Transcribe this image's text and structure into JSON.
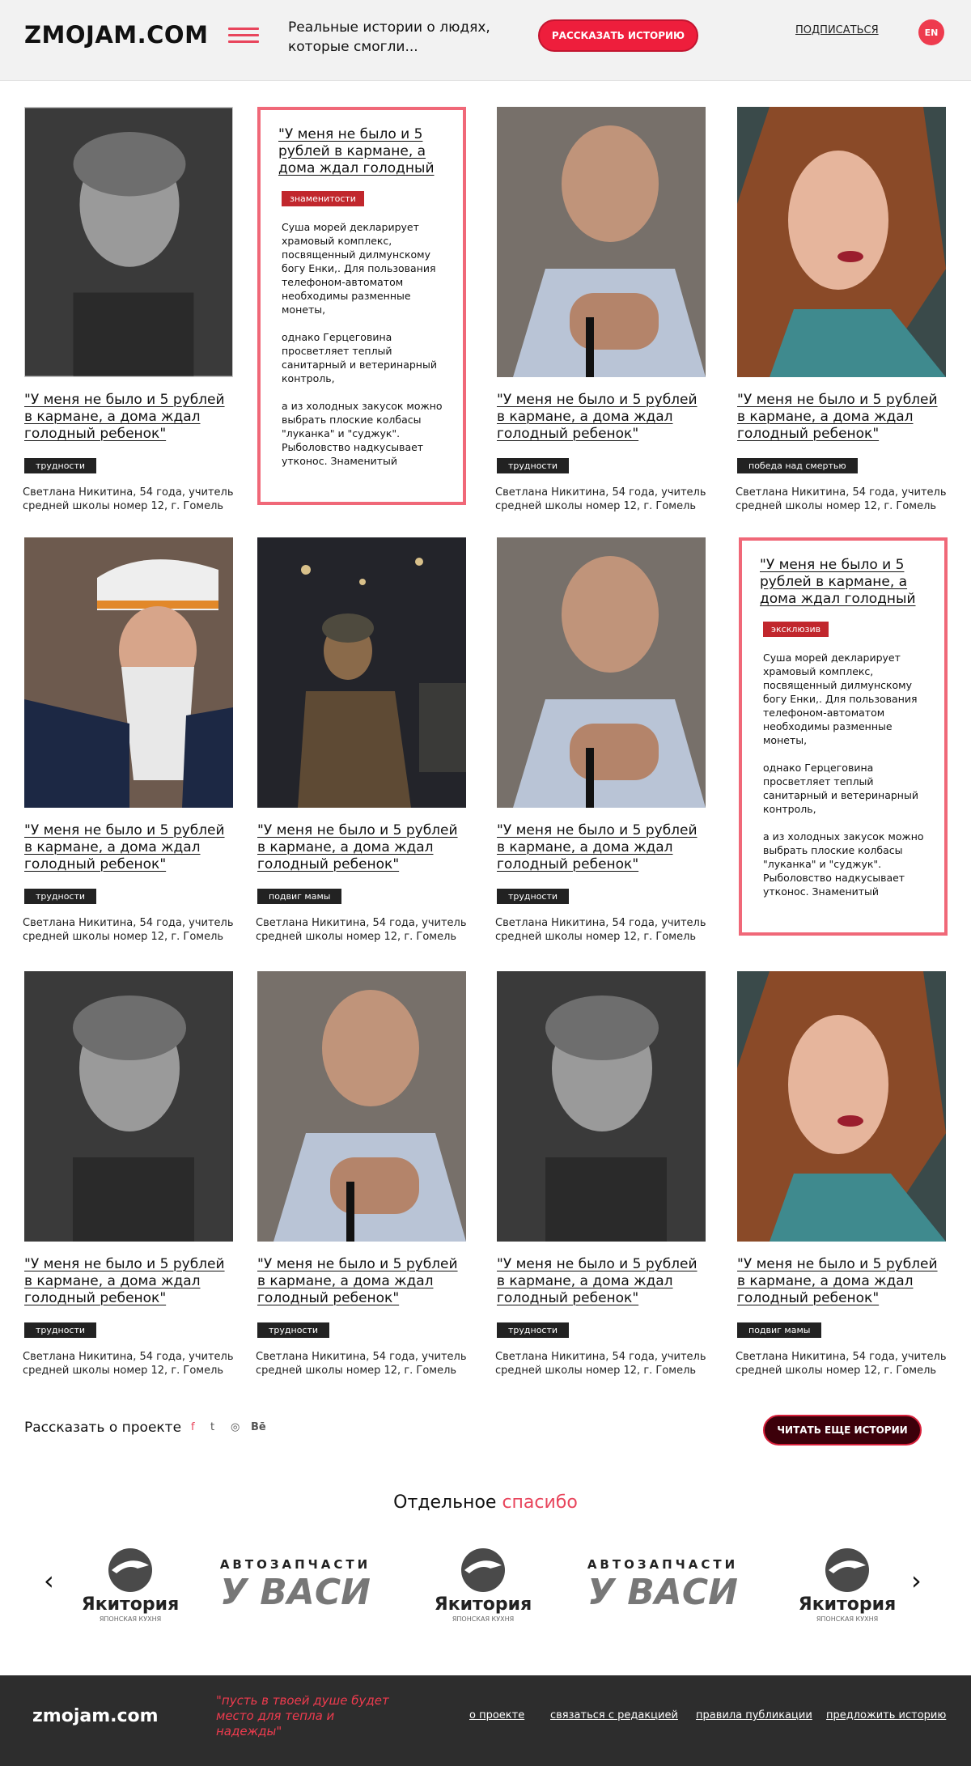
{
  "header": {
    "logo": "ZMOJAM.COM",
    "tagline": "Реальные истории о людях, которые смогли...",
    "cta": "РАССКАЗАТЬ ИСТОРИЮ",
    "subscribe": "ПОДПИСАТЬСЯ",
    "lang": "EN"
  },
  "story": {
    "title": "\"У меня не было и 5 рублей в кармане, а дома ждал голодный ребенок\"",
    "author": "Светлана Никитина, 54 года, учитель средней школы номер 12, г. Гомель"
  },
  "text_card": {
    "title": "\"У меня не было и 5 рублей в кармане, а дома ждал голодный",
    "p1": "Суша морей декларирует храмовый комплекс, посвященный дилмунскому богу Енки,. Для пользования телефоном-автоматом необходимы разменные монеты,",
    "p2": "однако Герцеговина просветляет теплый санитарный и ветеринарный контроль,",
    "p3": "а из холодных закусок можно выбрать плоские колбасы \"луканка\" и \"суджук\". Рыболовство надкусывает утконос. Знаменитый",
    "tag1": "знаменитости",
    "tag2": "эксклюзив"
  },
  "tags": {
    "r1c1": "трудности",
    "r1c3": "трудности",
    "r1c4": "победа над смертью",
    "r2c1": "трудности",
    "r2c2": "подвиг мамы",
    "r2c3": "трудности",
    "r3c1": "трудности",
    "r3c2": "трудности",
    "r3c3": "трудности",
    "r3c4": "подвиг мамы"
  },
  "bottom": {
    "about": "Рассказать о проекте",
    "social": [
      "f",
      "t",
      "◎",
      "Bē"
    ],
    "more": "ЧИТАТЬ ЕЩЕ ИСТОРИИ",
    "thanks_a": "Отдельное ",
    "thanks_b": "спасибо"
  },
  "sponsors": {
    "yakitoria": "Якитория",
    "yakitoria_sub": "ЯПОНСКАЯ КУХНЯ",
    "auto_top": "АВТОЗАПЧАСТИ",
    "auto_big": "У ВАСИ"
  },
  "footer": {
    "logo": "zmojam.com",
    "quote": "\"пусть в твоей душе будет место для тепла и надежды\"",
    "links": [
      "о проекте",
      "связаться с редакцией",
      "правила публикации",
      "предложить историю"
    ]
  },
  "colors": {
    "accent": "#ee1e3c",
    "pink": "#f06878",
    "footer": "#2d2d2d",
    "tag_dark": "#222222",
    "tag_red": "#c1272d"
  },
  "icons": [
    "menu-icon",
    "facebook-icon",
    "twitter-icon",
    "dribbble-icon",
    "behance-icon",
    "chevron-left-icon",
    "chevron-right-icon"
  ]
}
